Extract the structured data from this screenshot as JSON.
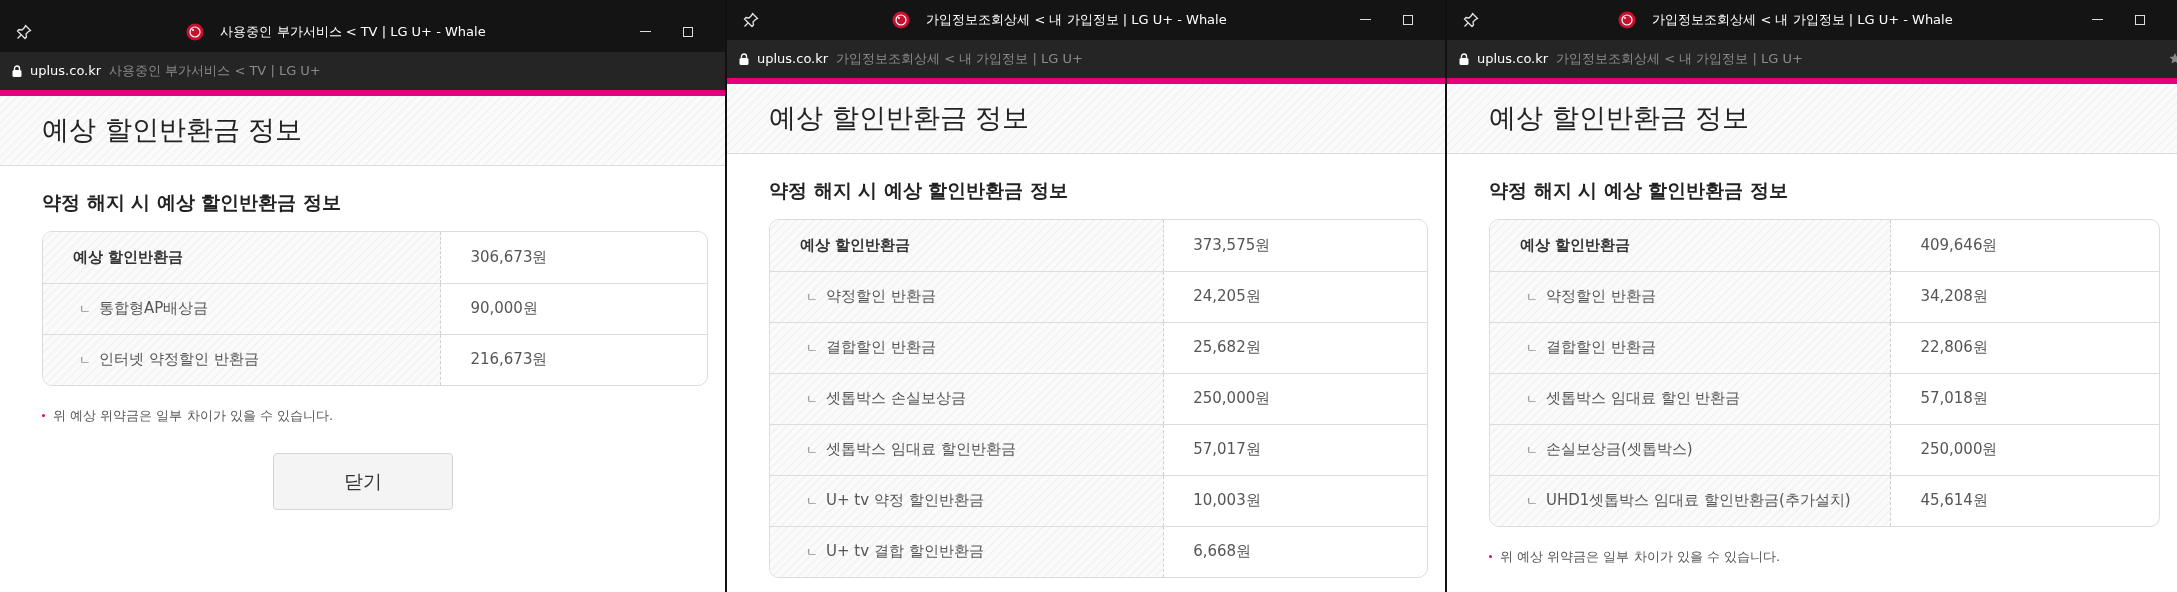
{
  "windows": [
    {
      "title": "사용중인 부가서비스 < TV | LG U+ - Whale",
      "address": {
        "domain": "uplus.co.kr",
        "page_title": "사용중인 부가서비스 < TV | LG U+"
      },
      "page_heading": "예상 할인반환금 정보",
      "section_title": "약정 해지 시 예상 할인반환금 정보",
      "rows": [
        {
          "kind": "total",
          "label": "예상 할인반환금",
          "value": "306,673원"
        },
        {
          "kind": "sub",
          "marker": "ㄴ",
          "label": "통합형AP배상금",
          "value": "90,000원"
        },
        {
          "kind": "sub",
          "marker": "ㄴ",
          "label": "인터넷 약정할인 반환금",
          "value": "216,673원"
        }
      ],
      "note": "위 예상 위약금은 일부 차이가 있을 수 있습니다.",
      "close_button": "닫기"
    },
    {
      "title": "가입정보조회상세 < 내 가입정보 | LG U+ - Whale",
      "address": {
        "domain": "uplus.co.kr",
        "page_title": "가입정보조회상세 < 내 가입정보 | LG U+"
      },
      "page_heading": "예상 할인반환금 정보",
      "section_title": "약정 해지 시 예상 할인반환금 정보",
      "rows": [
        {
          "kind": "total",
          "label": "예상 할인반환금",
          "value": "373,575원"
        },
        {
          "kind": "sub",
          "marker": "ㄴ",
          "label": "약정할인 반환금",
          "value": "24,205원"
        },
        {
          "kind": "sub",
          "marker": "ㄴ",
          "label": "결합할인 반환금",
          "value": "25,682원"
        },
        {
          "kind": "sub",
          "marker": "ㄴ",
          "label": "셋톱박스 손실보상금",
          "value": "250,000원"
        },
        {
          "kind": "sub",
          "marker": "ㄴ",
          "label": "셋톱박스 임대료 할인반환금",
          "value": "57,017원"
        },
        {
          "kind": "sub",
          "marker": "ㄴ",
          "label": "U+ tv 약정 할인반환금",
          "value": "10,003원"
        },
        {
          "kind": "sub",
          "marker": "ㄴ",
          "label": "U+ tv 결합 할인반환금",
          "value": "6,668원"
        }
      ]
    },
    {
      "title": "가입정보조회상세 < 내 가입정보 | LG U+ - Whale",
      "address": {
        "domain": "uplus.co.kr",
        "page_title": "가입정보조회상세 < 내 가입정보 | LG U+"
      },
      "page_heading": "예상 할인반환금 정보",
      "section_title": "약정 해지 시 예상 할인반환금 정보",
      "rows": [
        {
          "kind": "total",
          "label": "예상 할인반환금",
          "value": "409,646원"
        },
        {
          "kind": "sub",
          "marker": "ㄴ",
          "label": "약정할인 반환금",
          "value": "34,208원"
        },
        {
          "kind": "sub",
          "marker": "ㄴ",
          "label": "결합할인 반환금",
          "value": "22,806원"
        },
        {
          "kind": "sub",
          "marker": "ㄴ",
          "label": "셋톱박스 임대료 할인 반환금",
          "value": "57,018원"
        },
        {
          "kind": "sub",
          "marker": "ㄴ",
          "label": "손실보상금(셋톱박스)",
          "value": "250,000원"
        },
        {
          "kind": "sub",
          "marker": "ㄴ",
          "label": "UHD1셋톱박스 임대료 할인반환금(추가설치)",
          "value": "45,614원"
        }
      ],
      "note": "위 예상 위약금은 일부 차이가 있을 수 있습니다."
    }
  ]
}
